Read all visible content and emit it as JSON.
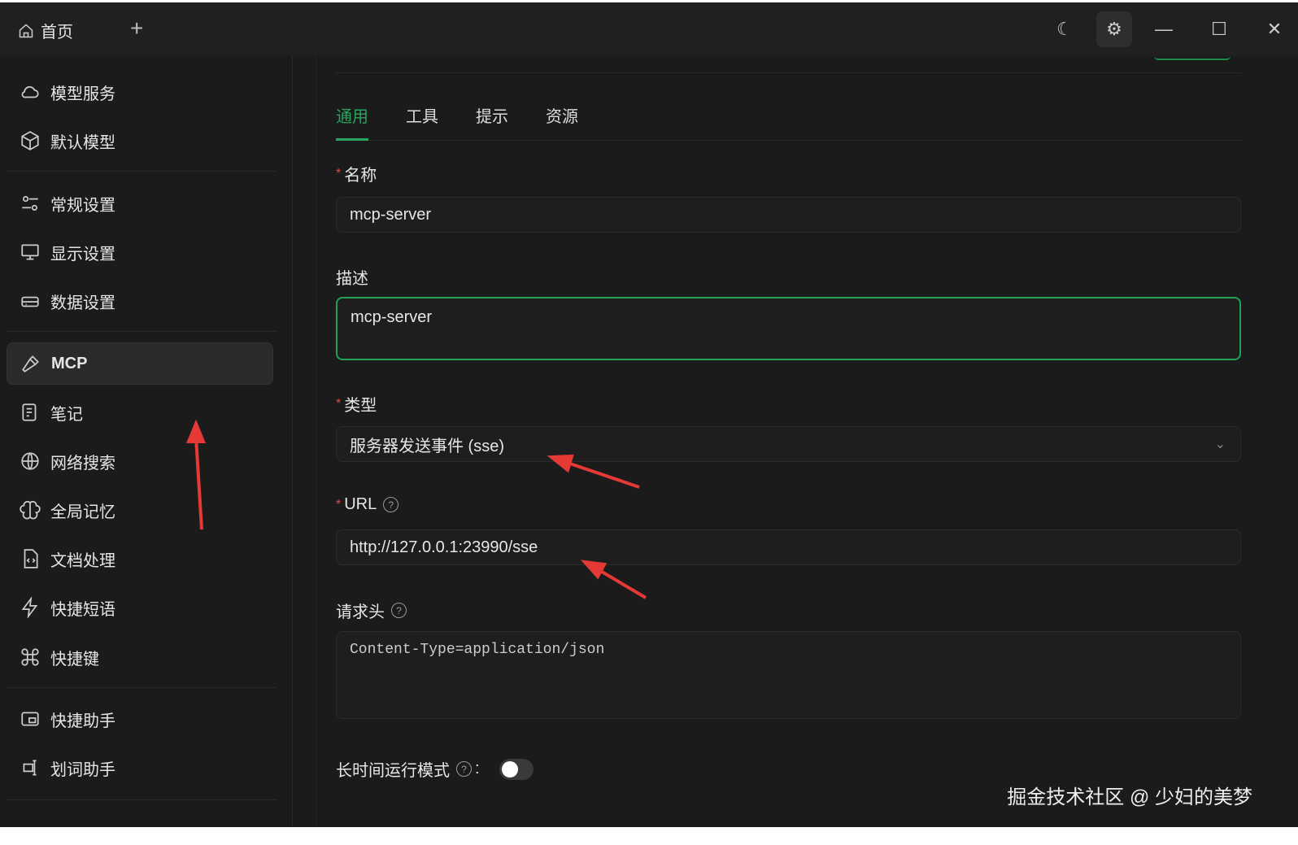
{
  "titlebar": {
    "home_tab": "首页"
  },
  "sidebar": {
    "items": [
      {
        "label": "模型服务",
        "icon": "cloud-icon"
      },
      {
        "label": "默认模型",
        "icon": "cube-icon"
      },
      {
        "label": "常规设置",
        "icon": "sliders-icon"
      },
      {
        "label": "显示设置",
        "icon": "monitor-icon"
      },
      {
        "label": "数据设置",
        "icon": "drive-icon"
      },
      {
        "label": "MCP",
        "icon": "hammer-icon"
      },
      {
        "label": "笔记",
        "icon": "note-icon"
      },
      {
        "label": "网络搜索",
        "icon": "globe-icon"
      },
      {
        "label": "全局记忆",
        "icon": "brain-icon"
      },
      {
        "label": "文档处理",
        "icon": "file-code-icon"
      },
      {
        "label": "快捷短语",
        "icon": "zap-icon"
      },
      {
        "label": "快捷键",
        "icon": "command-icon"
      },
      {
        "label": "快捷助手",
        "icon": "window-icon"
      },
      {
        "label": "划词助手",
        "icon": "text-cursor-icon"
      }
    ]
  },
  "tabs": [
    "通用",
    "工具",
    "提示",
    "资源"
  ],
  "form": {
    "name_label": "名称",
    "name_value": "mcp-server",
    "desc_label": "描述",
    "desc_value": "mcp-server",
    "type_label": "类型",
    "type_value": "服务器发送事件 (sse)",
    "url_label": "URL",
    "url_value": "http://127.0.0.1:23990/sse",
    "headers_label": "请求头",
    "headers_value": "Content-Type=application/json",
    "long_run_label": "长时间运行模式",
    "long_run_colon": ":",
    "long_run_on": false,
    "required_mark": "*",
    "help": "?"
  },
  "watermark": "掘金技术社区 @ 少妇的美梦",
  "colors": {
    "accent": "#2aa55f",
    "annotation": "#e53935"
  }
}
